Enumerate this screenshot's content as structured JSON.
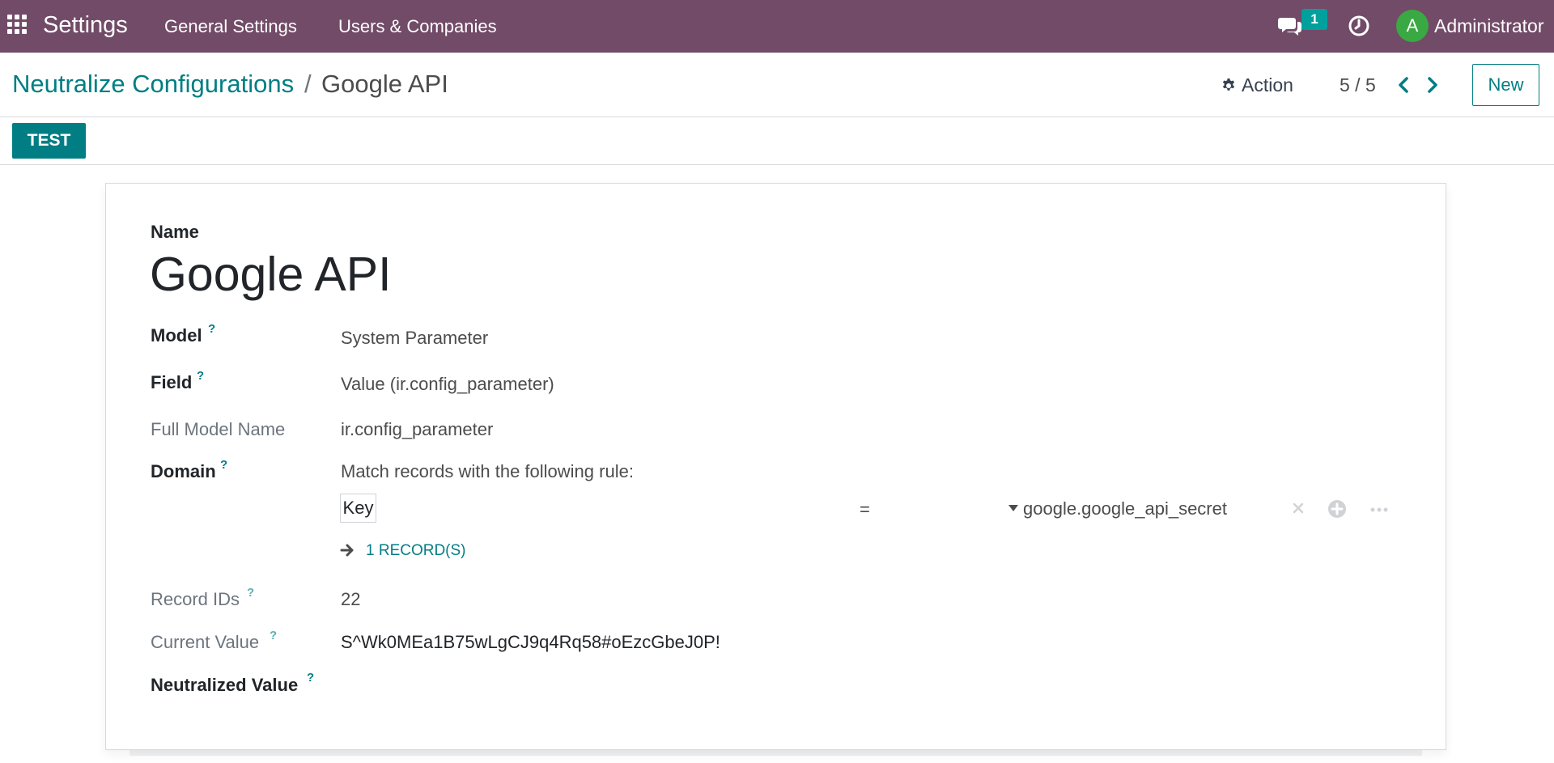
{
  "navbar": {
    "app_name": "Settings",
    "menu": [
      "General Settings",
      "Users & Companies"
    ],
    "chat_badge": "1",
    "avatar_initial": "A",
    "username": "Administrator",
    "bg_color": "#714b67"
  },
  "control_panel": {
    "breadcrumb_root": "Neutralize Configurations",
    "breadcrumb_sep": "/",
    "breadcrumb_current": "Google API",
    "action_label": "Action",
    "pager": "5 / 5",
    "new_label": "New"
  },
  "statusbar": {
    "test_label": "TEST"
  },
  "form": {
    "name_label": "Name",
    "name_value": "Google API",
    "model_label": "Model",
    "model_value": "System Parameter",
    "field_label": "Field",
    "field_value": "Value (ir.config_parameter)",
    "full_model_label": "Full Model Name",
    "full_model_value": "ir.config_parameter",
    "domain_label": "Domain",
    "domain_intro": "Match records with the following rule:",
    "domain_key": "Key",
    "domain_operator": "=",
    "domain_value": "google.google_api_secret",
    "records_link": "1 RECORD(S)",
    "record_ids_label": "Record IDs",
    "record_ids_value": "22",
    "current_value_label": "Current Value",
    "current_value": "S^Wk0MEa1B75wLgCJ9q4Rq58#oEzcGbeJ0P!",
    "neutralized_label": "Neutralized Value",
    "help_mark": "?"
  },
  "accent_color": "#017e84"
}
